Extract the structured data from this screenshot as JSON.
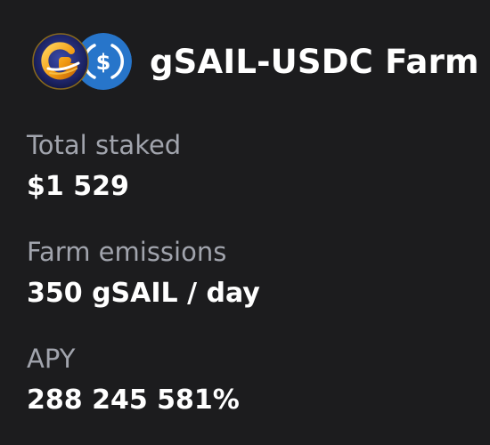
{
  "farm": {
    "title": "gSAIL-USDC Farm",
    "tokens": [
      {
        "icon": "gsail-token-icon",
        "color": "#f2a21b"
      },
      {
        "icon": "usdc-token-icon",
        "color": "#2775ca"
      }
    ]
  },
  "stats": {
    "total_staked": {
      "label": "Total staked",
      "value": "$1 529"
    },
    "emissions": {
      "label": "Farm emissions",
      "value": "350 gSAIL / day"
    },
    "apy": {
      "label": "APY",
      "value": "288 245 581%"
    }
  }
}
